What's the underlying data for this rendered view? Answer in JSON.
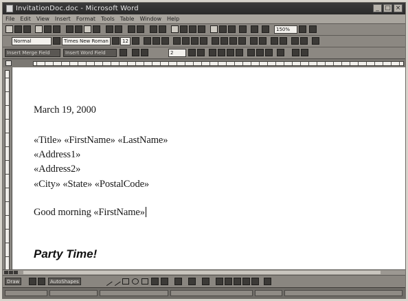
{
  "window": {
    "title": "InvitationDoc.doc - Microsoft Word"
  },
  "menu": {
    "items": [
      "File",
      "Edit",
      "View",
      "Insert",
      "Format",
      "Tools",
      "Table",
      "Window",
      "Help"
    ]
  },
  "toolbar_standard": {
    "zoom": "150%"
  },
  "toolbar_formatting": {
    "style": "Normal",
    "font": "Times New Roman",
    "size": "12"
  },
  "toolbar_mailmerge": {
    "insert_merge_field": "Insert Merge Field",
    "insert_word_field": "Insert Word Field",
    "record": "2"
  },
  "document": {
    "date": "March 19, 2000",
    "name_line": "«Title» «FirstName» «LastName»",
    "address1": "«Address1»",
    "address2": "«Address2»",
    "city_line": "«City» «State» «PostalCode»",
    "greeting": "Good morning «FirstName»",
    "heading": "Party Time!"
  },
  "drawing_toolbar": {
    "draw_label": "Draw",
    "autoshapes_label": "AutoShapes"
  }
}
